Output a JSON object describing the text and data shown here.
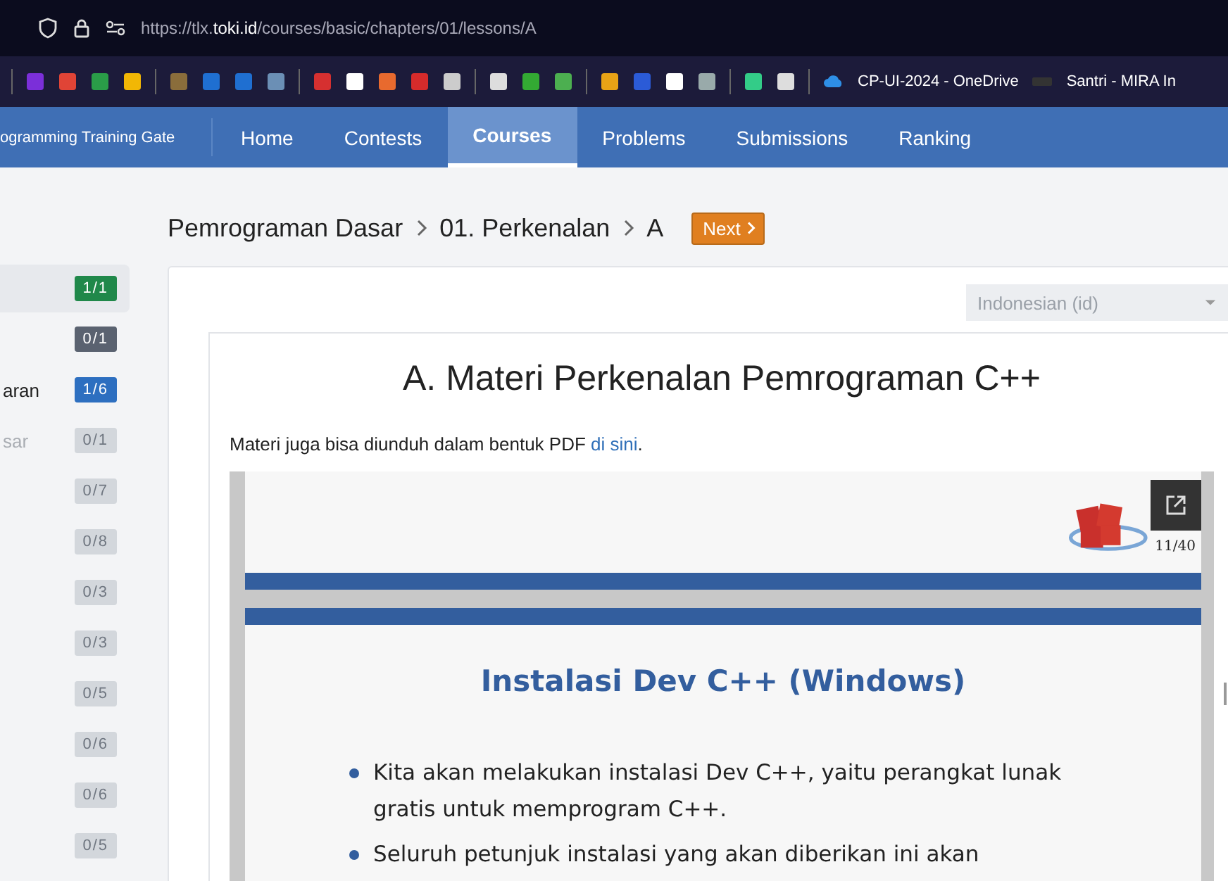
{
  "browser": {
    "url_prefix": "https://tlx.",
    "url_domain": "toki.id",
    "url_path": "/courses/basic/chapters/01/lessons/A"
  },
  "bookmarks": [
    "CP-UI-2024 - OneDrive",
    "Santri - MIRA In"
  ],
  "navbar": {
    "brand": "ogramming Training Gate",
    "items": [
      {
        "label": "Home",
        "selected": false
      },
      {
        "label": "Contests",
        "selected": false
      },
      {
        "label": "Courses",
        "selected": true
      },
      {
        "label": "Problems",
        "selected": false
      },
      {
        "label": "Submissions",
        "selected": false
      },
      {
        "label": "Ranking",
        "selected": false
      }
    ]
  },
  "sidebar": {
    "items": [
      {
        "progress": "1/1",
        "color": "#20884a",
        "disabled": false,
        "selected": true
      },
      {
        "progress": "0/1",
        "color": "#5a6270",
        "disabled": false,
        "selected": false
      },
      {
        "label": "aran",
        "progress": "1/6",
        "color": "#2d6fc0",
        "disabled": false,
        "selected": false
      },
      {
        "label": "sar",
        "progress": "0/1",
        "color": "#d3d7dc",
        "disabled": true,
        "selected": false
      },
      {
        "progress": "0/7",
        "color": "#d3d7dc",
        "disabled": true,
        "selected": false
      },
      {
        "progress": "0/8",
        "color": "#d3d7dc",
        "disabled": true,
        "selected": false
      },
      {
        "progress": "0/3",
        "color": "#d3d7dc",
        "disabled": true,
        "selected": false
      },
      {
        "progress": "0/3",
        "color": "#d3d7dc",
        "disabled": true,
        "selected": false
      },
      {
        "progress": "0/5",
        "color": "#d3d7dc",
        "disabled": true,
        "selected": false
      },
      {
        "progress": "0/6",
        "color": "#d3d7dc",
        "disabled": true,
        "selected": false
      },
      {
        "progress": "0/6",
        "color": "#d3d7dc",
        "disabled": true,
        "selected": false
      },
      {
        "progress": "0/5",
        "color": "#d3d7dc",
        "disabled": true,
        "selected": false
      }
    ]
  },
  "breadcrumb": [
    "Pemrograman Dasar",
    "01. Perkenalan",
    "A"
  ],
  "next_button": "Next",
  "language_select": {
    "value": "Indonesian (id)"
  },
  "lesson": {
    "title": "A. Materi Perkenalan Pemrograman C++",
    "intro": "Materi juga bisa diunduh dalam bentuk PDF ",
    "intro_link": "di sini",
    "intro_end": "."
  },
  "pdf": {
    "page_number": "11/40",
    "slide_title": "Instalasi Dev C++ (Windows)",
    "bullets": [
      "Kita akan melakukan instalasi Dev C++, yaitu perangkat lunak gratis untuk memprogram C++.",
      "Seluruh petunjuk instalasi yang akan diberikan ini akan"
    ]
  }
}
